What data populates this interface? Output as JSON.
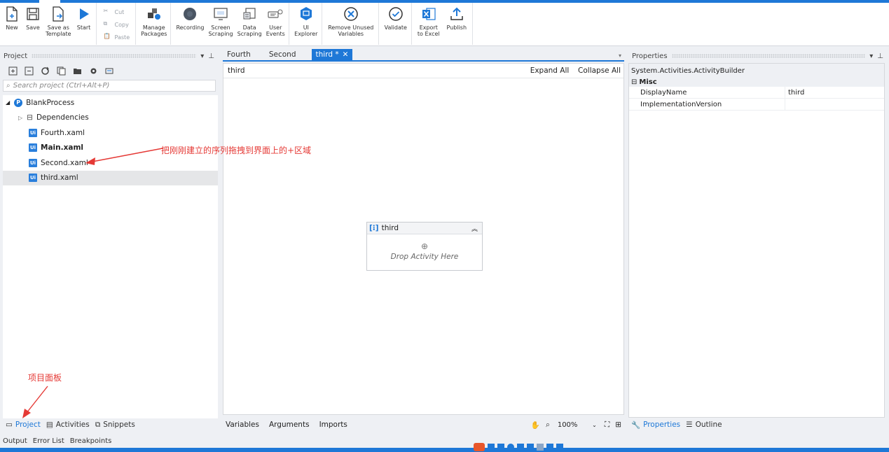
{
  "ribbon": {
    "new": "New",
    "save": "Save",
    "save_as_template": "Save as\nTemplate",
    "start": "Start",
    "cut": "Cut",
    "copy": "Copy",
    "paste": "Paste",
    "manage_packages": "Manage\nPackages",
    "recording": "Recording",
    "screen_scraping": "Screen\nScraping",
    "data_scraping": "Data\nScraping",
    "user_events": "User\nEvents",
    "ui_explorer": "UI\nExplorer",
    "remove_unused_variables": "Remove Unused\nVariables",
    "validate": "Validate",
    "export_to_excel": "Export\nto Excel",
    "publish": "Publish"
  },
  "project_panel": {
    "title": "Project",
    "search_placeholder": "Search project (Ctrl+Alt+P)",
    "root": "BlankProcess",
    "items": [
      {
        "label": "Dependencies"
      },
      {
        "label": "Fourth.xaml"
      },
      {
        "label": "Main.xaml"
      },
      {
        "label": "Second.xaml"
      },
      {
        "label": "third.xaml"
      }
    ],
    "bottom_tabs": [
      "Project",
      "Activities",
      "Snippets"
    ]
  },
  "designer": {
    "tabs": [
      "Fourth",
      "Second",
      "third *"
    ],
    "breadcrumb": "third",
    "expand_all": "Expand All",
    "collapse_all": "Collapse All",
    "sequence_title": "third",
    "drop_hint": "Drop Activity Here",
    "bottom_tabs": [
      "Variables",
      "Arguments",
      "Imports"
    ],
    "zoom": "100%"
  },
  "properties": {
    "title": "Properties",
    "class_name": "System.Activities.ActivityBuilder",
    "category": "Misc",
    "rows": [
      {
        "name": "DisplayName",
        "value": "third"
      },
      {
        "name": "ImplementationVersion",
        "value": ""
      }
    ],
    "bottom_tabs": [
      "Properties",
      "Outline"
    ]
  },
  "output_bar": [
    "Output",
    "Error List",
    "Breakpoints"
  ],
  "annotations": {
    "drag_hint": "把刚刚建立的序列拖拽到界面上的+区域",
    "panel_hint": "项目面板"
  },
  "colors": {
    "accent": "#1e78d7",
    "annotation": "#e53935",
    "ui_badge": "#2a7fdc"
  }
}
